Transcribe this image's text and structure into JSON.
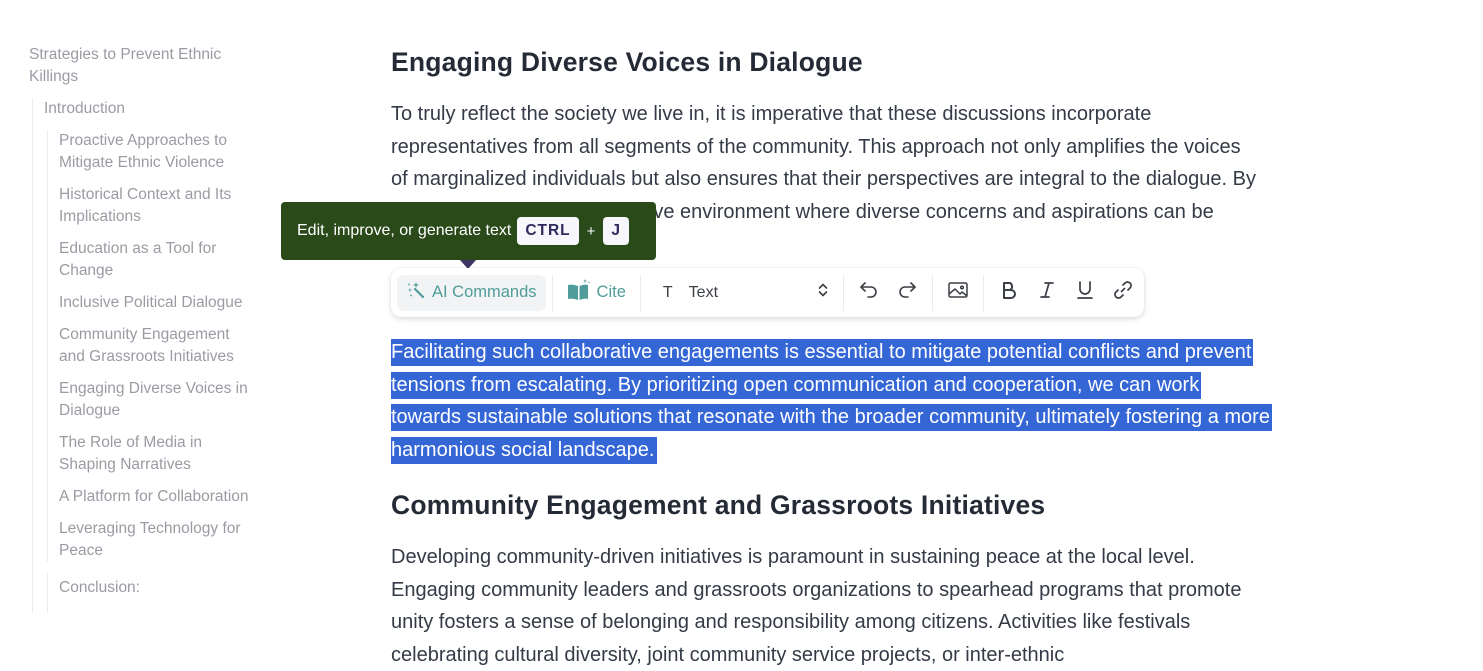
{
  "outline": {
    "root": "Strategies to Prevent Ethnic Killings",
    "introduction": "Introduction",
    "items": [
      "Proactive Approaches to Mitigate Ethnic Violence",
      "Historical Context and Its Implications",
      "Education as a Tool for Change",
      "Inclusive Political Dialogue",
      "Community Engagement and Grassroots Initiatives",
      "Engaging Diverse Voices in Dialogue",
      "The Role of Media in Shaping Narratives",
      "A Platform for Collaboration",
      "Leveraging Technology for Peace"
    ],
    "conclusion": "Conclusion:"
  },
  "document": {
    "heading1": "Engaging Diverse Voices in Dialogue",
    "paragraph1": "To truly reflect the society we live in, it is imperative that these discussions incorporate representatives from all segments of the community. This approach not only amplifies the voices of marginalized individuals but also ensures that their perspectives are integral to the dialogue. By doing so, we create an inclusive environment where diverse concerns and aspirations can be addressed collectively.",
    "paragraph2_selected": "Facilitating such collaborative engagements is essential to mitigate potential conflicts and prevent tensions from escalating. By prioritizing open communication and cooperation, we can work towards sustainable solutions that resonate with the broader community, ultimately fostering a more harmonious social landscape.",
    "heading2": "Community Engagement and Grassroots Initiatives",
    "paragraph3": "Developing community-driven initiatives is paramount in sustaining peace at the local level. Engaging community leaders and grassroots organizations to spearhead programs that promote unity fosters a sense of belonging and responsibility among citizens. Activities like festivals celebrating cultural diversity, joint community service projects, or inter-ethnic"
  },
  "tooltip": {
    "text": "Edit, improve, or generate text",
    "key1": "CTRL",
    "plus": "+",
    "key2": "J"
  },
  "toolbar": {
    "ai_commands_label": "AI Commands",
    "cite_label": "Cite",
    "text_style_glyph": "T",
    "text_style_value": "Text",
    "icons": [
      "magic-wand-icon",
      "book-sparkle-icon",
      "text-type-icon",
      "chevron-up-down-icon",
      "undo-icon",
      "redo-icon",
      "image-icon",
      "bold-icon",
      "italic-icon",
      "underline-icon",
      "link-icon"
    ]
  },
  "colors": {
    "accent_teal": "#4f9c9a",
    "selection_blue": "#3566d6",
    "tooltip_green": "#2a4a1a",
    "outline_gray": "#9a9ca3"
  }
}
